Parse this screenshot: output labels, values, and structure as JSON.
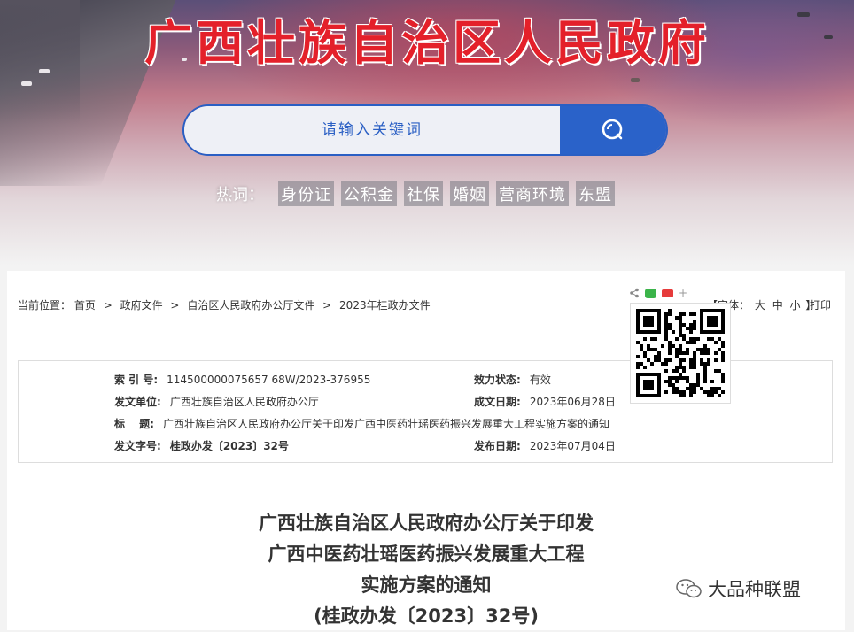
{
  "banner": {
    "site_title": "广西壮族自治区人民政府",
    "search": {
      "placeholder": "请输入关键词"
    },
    "hot": {
      "label": "热词：",
      "tags": [
        "身份证",
        "公积金",
        "社保",
        "婚姻",
        "营商环境",
        "东盟"
      ]
    }
  },
  "breadcrumb": {
    "prefix": "当前位置：",
    "items": [
      "首页",
      "政府文件",
      "自治区人民政府办公厅文件",
      "2023年桂政办文件"
    ],
    "separator": ">"
  },
  "tools": {
    "font_prefix": "【字体：",
    "font_large": "大",
    "font_medium": "中",
    "font_small": "小",
    "font_suffix": "】",
    "print": "打印",
    "share_plus": "+"
  },
  "info": {
    "index_label": "索 引 号:",
    "index_value": "114500000075657 68W/2023-376955",
    "status_label": "效力状态:",
    "status_value": "有效",
    "issuer_label": "发文单位:",
    "issuer_value": "广西壮族自治区人民政府办公厅",
    "created_label": "成文日期:",
    "created_value": "2023年06月28日",
    "title_label": "标　 题:",
    "title_value": "广西壮族自治区人民政府办公厅关于印发广西中医药壮瑶医药振兴发展重大工程实施方案的通知",
    "docno_label": "发文字号:",
    "docno_value": "桂政办发〔2023〕32号",
    "published_label": "发布日期:",
    "published_value": "2023年07月04日"
  },
  "document": {
    "title_lines": [
      "广西壮族自治区人民政府办公厅关于印发",
      "广西中医药壮瑶医药振兴发展重大工程",
      "实施方案的通知",
      "(桂政办发〔2023〕32号)"
    ]
  },
  "watermark": {
    "text": "大品种联盟"
  },
  "colors": {
    "title_red": "#e4202a",
    "search_blue": "#2a62c9"
  }
}
